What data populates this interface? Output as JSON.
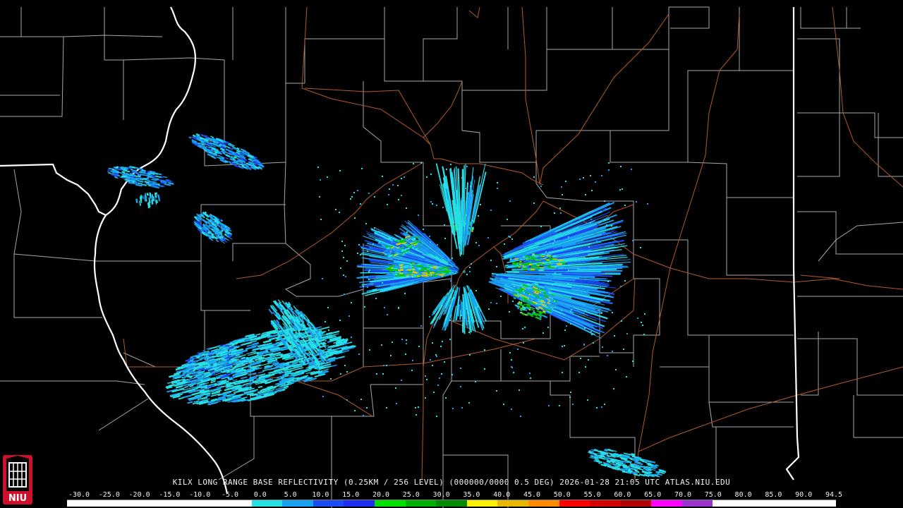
{
  "product": {
    "caption": "KILX LONG RANGE BASE REFLECTIVITY (0.25KM / 256 LEVEL) (000000/0000 0.5 DEG) 2026-01-28 21:05 UTC  ATLAS.NIU.EDU"
  },
  "logo": {
    "text": "NIU"
  },
  "scale": {
    "labels": [
      "-30.0",
      "-25.0",
      "-20.0",
      "-15.0",
      "-10.0",
      "-5.0",
      "0.0",
      "5.0",
      "10.0",
      "15.0",
      "20.0",
      "25.0",
      "30.0",
      "35.0",
      "40.0",
      "45.0",
      "50.0",
      "55.0",
      "60.0",
      "65.0",
      "70.0",
      "75.0",
      "80.0",
      "85.0",
      "90.0",
      "94.5"
    ],
    "colors": [
      "#ffffff",
      "#ffffff",
      "#ffffff",
      "#ffffff",
      "#ffffff",
      "#ffffff",
      "#27e0e6",
      "#1aa0f0",
      "#1a4cf2",
      "#1e2df0",
      "#00e000",
      "#00b000",
      "#008a00",
      "#fff200",
      "#e6b800",
      "#ff8c00",
      "#ff0000",
      "#d40000",
      "#b00000",
      "#ff00ff",
      "#9933cc",
      "#ffffff",
      "#ffffff",
      "#ffffff",
      "#ffffff"
    ]
  },
  "colors": {
    "county_lines": "#a8a8a8",
    "state_lines": "#ffffff",
    "roads": "#b35a2a",
    "echo_light": "#27e0e6",
    "echo_medium": "#1aa0f0",
    "echo_blue": "#1a4cf2",
    "echo_green": "#00c800",
    "echo_yellow": "#e6c800"
  }
}
